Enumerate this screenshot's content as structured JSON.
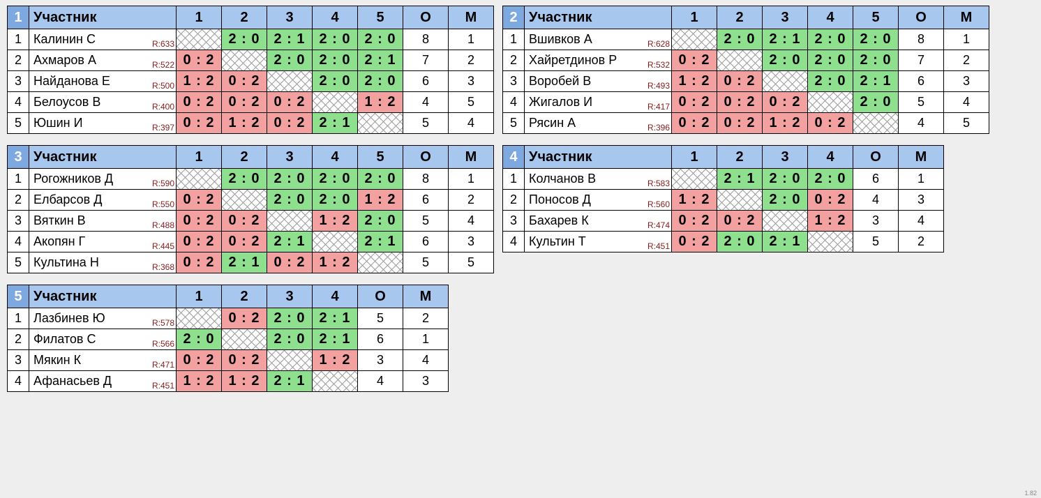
{
  "labels": {
    "participant": "Участник",
    "sum": "О",
    "place": "М"
  },
  "version": "1.82",
  "groups": [
    {
      "id": "1",
      "size": 5,
      "rows": [
        {
          "n": 1,
          "name": "Калинин С",
          "rating": "R:633",
          "cells": [
            null,
            {
              "t": "2 : 0",
              "r": "w"
            },
            {
              "t": "2 : 1",
              "r": "w"
            },
            {
              "t": "2 : 0",
              "r": "w"
            },
            {
              "t": "2 : 0",
              "r": "w"
            }
          ],
          "sum": 8,
          "place": 1
        },
        {
          "n": 2,
          "name": "Ахмаров А",
          "rating": "R:522",
          "cells": [
            {
              "t": "0 : 2",
              "r": "l"
            },
            null,
            {
              "t": "2 : 0",
              "r": "w"
            },
            {
              "t": "2 : 0",
              "r": "w"
            },
            {
              "t": "2 : 1",
              "r": "w"
            }
          ],
          "sum": 7,
          "place": 2
        },
        {
          "n": 3,
          "name": "Найданова Е",
          "rating": "R:500",
          "cells": [
            {
              "t": "1 : 2",
              "r": "l"
            },
            {
              "t": "0 : 2",
              "r": "l"
            },
            null,
            {
              "t": "2 : 0",
              "r": "w"
            },
            {
              "t": "2 : 0",
              "r": "w"
            }
          ],
          "sum": 6,
          "place": 3
        },
        {
          "n": 4,
          "name": "Белоусов В",
          "rating": "R:400",
          "cells": [
            {
              "t": "0 : 2",
              "r": "l"
            },
            {
              "t": "0 : 2",
              "r": "l"
            },
            {
              "t": "0 : 2",
              "r": "l"
            },
            null,
            {
              "t": "1 : 2",
              "r": "l"
            }
          ],
          "sum": 4,
          "place": 5
        },
        {
          "n": 5,
          "name": "Юшин И",
          "rating": "R:397",
          "cells": [
            {
              "t": "0 : 2",
              "r": "l"
            },
            {
              "t": "1 : 2",
              "r": "l"
            },
            {
              "t": "0 : 2",
              "r": "l"
            },
            {
              "t": "2 : 1",
              "r": "w"
            },
            null
          ],
          "sum": 5,
          "place": 4
        }
      ]
    },
    {
      "id": "2",
      "size": 5,
      "rows": [
        {
          "n": 1,
          "name": "Вшивков А",
          "rating": "R:628",
          "cells": [
            null,
            {
              "t": "2 : 0",
              "r": "w"
            },
            {
              "t": "2 : 1",
              "r": "w"
            },
            {
              "t": "2 : 0",
              "r": "w"
            },
            {
              "t": "2 : 0",
              "r": "w"
            }
          ],
          "sum": 8,
          "place": 1
        },
        {
          "n": 2,
          "name": "Хайретдинов Р",
          "rating": "R:532",
          "cells": [
            {
              "t": "0 : 2",
              "r": "l"
            },
            null,
            {
              "t": "2 : 0",
              "r": "w"
            },
            {
              "t": "2 : 0",
              "r": "w"
            },
            {
              "t": "2 : 0",
              "r": "w"
            }
          ],
          "sum": 7,
          "place": 2
        },
        {
          "n": 3,
          "name": "Воробей В",
          "rating": "R:493",
          "cells": [
            {
              "t": "1 : 2",
              "r": "l"
            },
            {
              "t": "0 : 2",
              "r": "l"
            },
            null,
            {
              "t": "2 : 0",
              "r": "w"
            },
            {
              "t": "2 : 1",
              "r": "w"
            }
          ],
          "sum": 6,
          "place": 3
        },
        {
          "n": 4,
          "name": "Жигалов И",
          "rating": "R:417",
          "cells": [
            {
              "t": "0 : 2",
              "r": "l"
            },
            {
              "t": "0 : 2",
              "r": "l"
            },
            {
              "t": "0 : 2",
              "r": "l"
            },
            null,
            {
              "t": "2 : 0",
              "r": "w"
            }
          ],
          "sum": 5,
          "place": 4
        },
        {
          "n": 5,
          "name": "Рясин А",
          "rating": "R:396",
          "cells": [
            {
              "t": "0 : 2",
              "r": "l"
            },
            {
              "t": "0 : 2",
              "r": "l"
            },
            {
              "t": "1 : 2",
              "r": "l"
            },
            {
              "t": "0 : 2",
              "r": "l"
            },
            null
          ],
          "sum": 4,
          "place": 5
        }
      ]
    },
    {
      "id": "3",
      "size": 5,
      "rows": [
        {
          "n": 1,
          "name": "Рогожников Д",
          "rating": "R:590",
          "cells": [
            null,
            {
              "t": "2 : 0",
              "r": "w"
            },
            {
              "t": "2 : 0",
              "r": "w"
            },
            {
              "t": "2 : 0",
              "r": "w"
            },
            {
              "t": "2 : 0",
              "r": "w"
            }
          ],
          "sum": 8,
          "place": 1
        },
        {
          "n": 2,
          "name": "Елбарсов Д",
          "rating": "R:550",
          "cells": [
            {
              "t": "0 : 2",
              "r": "l"
            },
            null,
            {
              "t": "2 : 0",
              "r": "w"
            },
            {
              "t": "2 : 0",
              "r": "w"
            },
            {
              "t": "1 : 2",
              "r": "l"
            }
          ],
          "sum": 6,
          "place": 2
        },
        {
          "n": 3,
          "name": "Вяткин В",
          "rating": "R:488",
          "cells": [
            {
              "t": "0 : 2",
              "r": "l"
            },
            {
              "t": "0 : 2",
              "r": "l"
            },
            null,
            {
              "t": "1 : 2",
              "r": "l"
            },
            {
              "t": "2 : 0",
              "r": "w"
            }
          ],
          "sum": 5,
          "place": 4
        },
        {
          "n": 4,
          "name": "Акопян Г",
          "rating": "R:445",
          "cells": [
            {
              "t": "0 : 2",
              "r": "l"
            },
            {
              "t": "0 : 2",
              "r": "l"
            },
            {
              "t": "2 : 1",
              "r": "w"
            },
            null,
            {
              "t": "2 : 1",
              "r": "w"
            }
          ],
          "sum": 6,
          "place": 3
        },
        {
          "n": 5,
          "name": "Культина Н",
          "rating": "R:368",
          "cells": [
            {
              "t": "0 : 2",
              "r": "l"
            },
            {
              "t": "2 : 1",
              "r": "w"
            },
            {
              "t": "0 : 2",
              "r": "l"
            },
            {
              "t": "1 : 2",
              "r": "l"
            },
            null
          ],
          "sum": 5,
          "place": 5
        }
      ]
    },
    {
      "id": "4",
      "size": 4,
      "rows": [
        {
          "n": 1,
          "name": "Колчанов В",
          "rating": "R:583",
          "cells": [
            null,
            {
              "t": "2 : 1",
              "r": "w"
            },
            {
              "t": "2 : 0",
              "r": "w"
            },
            {
              "t": "2 : 0",
              "r": "w"
            }
          ],
          "sum": 6,
          "place": 1
        },
        {
          "n": 2,
          "name": "Поносов Д",
          "rating": "R:560",
          "cells": [
            {
              "t": "1 : 2",
              "r": "l"
            },
            null,
            {
              "t": "2 : 0",
              "r": "w"
            },
            {
              "t": "0 : 2",
              "r": "l"
            }
          ],
          "sum": 4,
          "place": 3
        },
        {
          "n": 3,
          "name": "Бахарев К",
          "rating": "R:474",
          "cells": [
            {
              "t": "0 : 2",
              "r": "l"
            },
            {
              "t": "0 : 2",
              "r": "l"
            },
            null,
            {
              "t": "1 : 2",
              "r": "l"
            }
          ],
          "sum": 3,
          "place": 4
        },
        {
          "n": 4,
          "name": "Культин Т",
          "rating": "R:451",
          "cells": [
            {
              "t": "0 : 2",
              "r": "l"
            },
            {
              "t": "2 : 0",
              "r": "w"
            },
            {
              "t": "2 : 1",
              "r": "w"
            },
            null
          ],
          "sum": 5,
          "place": 2
        }
      ]
    },
    {
      "id": "5",
      "size": 4,
      "rows": [
        {
          "n": 1,
          "name": "Лазбинев Ю",
          "rating": "R:578",
          "cells": [
            null,
            {
              "t": "0 : 2",
              "r": "l"
            },
            {
              "t": "2 : 0",
              "r": "w"
            },
            {
              "t": "2 : 1",
              "r": "w"
            }
          ],
          "sum": 5,
          "place": 2
        },
        {
          "n": 2,
          "name": "Филатов С",
          "rating": "R:566",
          "cells": [
            {
              "t": "2 : 0",
              "r": "w"
            },
            null,
            {
              "t": "2 : 0",
              "r": "w"
            },
            {
              "t": "2 : 1",
              "r": "w"
            }
          ],
          "sum": 6,
          "place": 1
        },
        {
          "n": 3,
          "name": "Мякин К",
          "rating": "R:471",
          "cells": [
            {
              "t": "0 : 2",
              "r": "l"
            },
            {
              "t": "0 : 2",
              "r": "l"
            },
            null,
            {
              "t": "1 : 2",
              "r": "l"
            }
          ],
          "sum": 3,
          "place": 4
        },
        {
          "n": 4,
          "name": "Афанасьев Д",
          "rating": "R:451",
          "cells": [
            {
              "t": "1 : 2",
              "r": "l"
            },
            {
              "t": "1 : 2",
              "r": "l"
            },
            {
              "t": "2 : 1",
              "r": "w"
            },
            null
          ],
          "sum": 4,
          "place": 3
        }
      ]
    }
  ]
}
